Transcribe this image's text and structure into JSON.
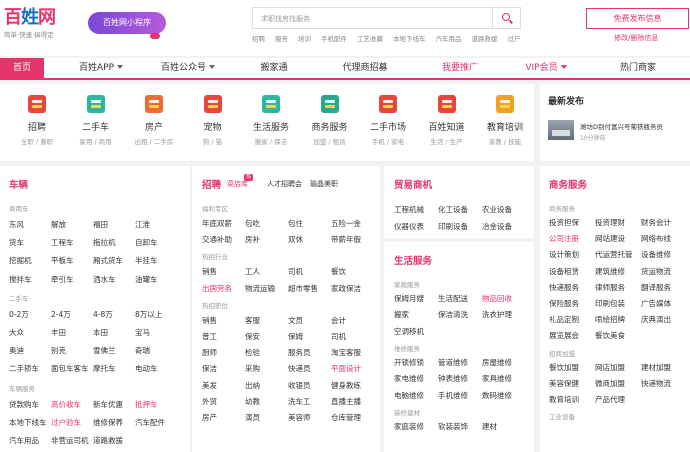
{
  "header": {
    "logo_text": "百姓网",
    "logo_slogan": "简单·快速·搞得定",
    "miniprogram_label": "百姓网小程序",
    "search_placeholder": "求职找房找服务",
    "hot_searches": [
      "招聘",
      "服务",
      "培训",
      "手机配件",
      "工艺收藏",
      "本地下线车",
      "汽车用品",
      "道路救援",
      "过户"
    ],
    "post_button": "免费发布信息",
    "post_sub": "修改/删除信息"
  },
  "nav": [
    {
      "label": "首页",
      "active": true
    },
    {
      "label": "百姓APP",
      "caret": true
    },
    {
      "label": "百姓公众号",
      "caret": true
    },
    {
      "label": "搬家通"
    },
    {
      "label": "代理商招募"
    },
    {
      "label": "我要推广",
      "pink": true
    },
    {
      "label": "VIP会员",
      "caret": true,
      "pink": true
    },
    {
      "label": "热门商家"
    }
  ],
  "categories": [
    {
      "title": "招聘",
      "sub": "全职 / 兼职",
      "icon": "recruit-icon",
      "color": "#e8453c"
    },
    {
      "title": "二手车",
      "sub": "家用 / 商用",
      "icon": "used-car-icon",
      "color": "#2bb7a1"
    },
    {
      "title": "房产",
      "sub": "出租 / 二手房",
      "icon": "house-icon",
      "color": "#ef6b35"
    },
    {
      "title": "宠物",
      "sub": "狗 / 猫",
      "icon": "pet-icon",
      "color": "#e8453c"
    },
    {
      "title": "生活服务",
      "sub": "搬家 / 保洁",
      "icon": "life-service-icon",
      "color": "#2bb7a1"
    },
    {
      "title": "商务服务",
      "sub": "加盟 / 租赁",
      "icon": "business-icon",
      "color": "#27a990"
    },
    {
      "title": "二手市场",
      "sub": "手机 / 家电",
      "icon": "market-cart-icon",
      "color": "#e8453c"
    },
    {
      "title": "百姓知道",
      "sub": "生活 / 生产",
      "icon": "knowledge-icon",
      "color": "#e8453c"
    },
    {
      "title": "教育培训",
      "sub": "家教 / 技能",
      "icon": "education-icon",
      "color": "#f0a020"
    }
  ],
  "news": {
    "heading": "最新发布",
    "item_title": "潍坊D别付富兴号葡铁瓶务员",
    "item_time": "10分钟前"
  },
  "vehicle": {
    "title": "车辆",
    "sections": [
      {
        "label": "商用车",
        "rows": [
          [
            "东风",
            "解放",
            "福田",
            "江淮"
          ],
          [
            "货车",
            "工程车",
            "拖拉机",
            "自卸车"
          ],
          [
            "挖掘机",
            "平板车",
            "厢式货车",
            "半挂车"
          ],
          [
            "搅拌车",
            "牵引车",
            "洒水车",
            "油罐车"
          ]
        ]
      },
      {
        "label": "二手车",
        "rows": [
          [
            "0-2万",
            "2-4万",
            "4-8万",
            "8万以上"
          ],
          [
            "大众",
            "丰田",
            "本田",
            "宝马"
          ],
          [
            "奥迪",
            "别克",
            "雪佛兰",
            "奇瑞"
          ],
          [
            "二手轿车",
            "面包车客车",
            "摩托车",
            "电动车"
          ]
        ]
      },
      {
        "label": "车辆服务",
        "rows": [
          [
            "贷款购车",
            "高价收车",
            "新车优惠",
            "抵押车"
          ],
          [
            "本地下线车",
            "过户验车",
            "维修保养",
            "汽车配件"
          ],
          [
            "汽车用品",
            "非营运司机",
            "道路救援",
            ""
          ]
        ]
      }
    ],
    "red_items": [
      "高价收车",
      "抵押车",
      "过户验车"
    ]
  },
  "recruit": {
    "title": "招聘",
    "tabs": [
      "菜店库",
      "人才招聘会",
      "瑜晶美职"
    ],
    "hot_badge": "热",
    "sections": [
      {
        "label": "福利专区",
        "rows": [
          [
            "年底双薪",
            "包吃",
            "包住",
            "五险一金"
          ],
          [
            "交通补助",
            "房补",
            "双休",
            "带薪年假"
          ]
        ]
      },
      {
        "label": "热招行业",
        "rows": [
          [
            "销售",
            "工人",
            "司机",
            "餐饮"
          ],
          [
            "出国劳务",
            "物流运输",
            "超市零售",
            "家政保洁"
          ]
        ]
      },
      {
        "label": "热招职位",
        "rows": [
          [
            "销售",
            "客服",
            "文员",
            "会计"
          ],
          [
            "普工",
            "保安",
            "保姆",
            "司机"
          ],
          [
            "厨师",
            "检验",
            "服务员",
            "淘宝客服"
          ],
          [
            "保洁",
            "采购",
            "快递员",
            "平面设计"
          ],
          [
            "美发",
            "出纳",
            "收银员",
            "健身教练"
          ],
          [
            "外贸",
            "幼教",
            "洗车工",
            "直播主播"
          ],
          [
            "房产",
            "演员",
            "美容师",
            "仓库管理"
          ]
        ]
      }
    ],
    "red_items": [
      "出国劳务",
      "平面设计"
    ]
  },
  "trade": {
    "title": "贸易商机",
    "rows": [
      [
        "工程机械",
        "化工设备",
        "农业设备"
      ],
      [
        "仪器仪表",
        "印刷设备",
        "冶金设备"
      ]
    ]
  },
  "life": {
    "title": "生活服务",
    "sections": [
      {
        "label": "家政服务",
        "rows": [
          [
            "保姆月嫂",
            "生活配送",
            "物品回收"
          ],
          [
            "搬家",
            "保洁清洗",
            "洗衣护理"
          ],
          [
            "空调移机",
            "",
            ""
          ]
        ]
      },
      {
        "label": "维修服务",
        "rows": [
          [
            "开锁修锁",
            "管道维修",
            "房屋维修"
          ],
          [
            "家电维修",
            "钟表维修",
            "家具维修"
          ],
          [
            "电脑维修",
            "手机维修",
            "数码维修"
          ]
        ]
      },
      {
        "label": "装修建材",
        "rows": [
          [
            "家庭装修",
            "软装装饰",
            "建材"
          ]
        ]
      }
    ],
    "red_items": [
      "物品回收"
    ]
  },
  "business": {
    "title": "商务服务",
    "sections": [
      {
        "label": "商务服务",
        "rows": [
          [
            "投资担保",
            "投资理财",
            "财务会计"
          ],
          [
            "公司注册",
            "网站建设",
            "网络布线"
          ],
          [
            "设计策划",
            "代运营托管",
            "设备维修"
          ],
          [
            "设备租赁",
            "建筑维修",
            "货运物流"
          ],
          [
            "快递服务",
            "律师服务",
            "翻译服务"
          ],
          [
            "保险服务",
            "印刷包装",
            "广告媒体"
          ],
          [
            "礼品定制",
            "喷绘招牌",
            "庆典演出"
          ],
          [
            "展览展会",
            "餐饮美食",
            ""
          ]
        ]
      },
      {
        "label": "招商加盟",
        "rows": [
          [
            "餐饮加盟",
            "网店加盟",
            "建材加盟"
          ],
          [
            "美容保健",
            "微商加盟",
            "快递物流"
          ],
          [
            "教育培训",
            "产品代理",
            ""
          ]
        ]
      },
      {
        "label": "工业设备",
        "rows": []
      }
    ],
    "red_items": [
      "公司注册"
    ]
  },
  "colors": {
    "accent": "#e5336c",
    "link_blue": "#1b6fc6"
  }
}
